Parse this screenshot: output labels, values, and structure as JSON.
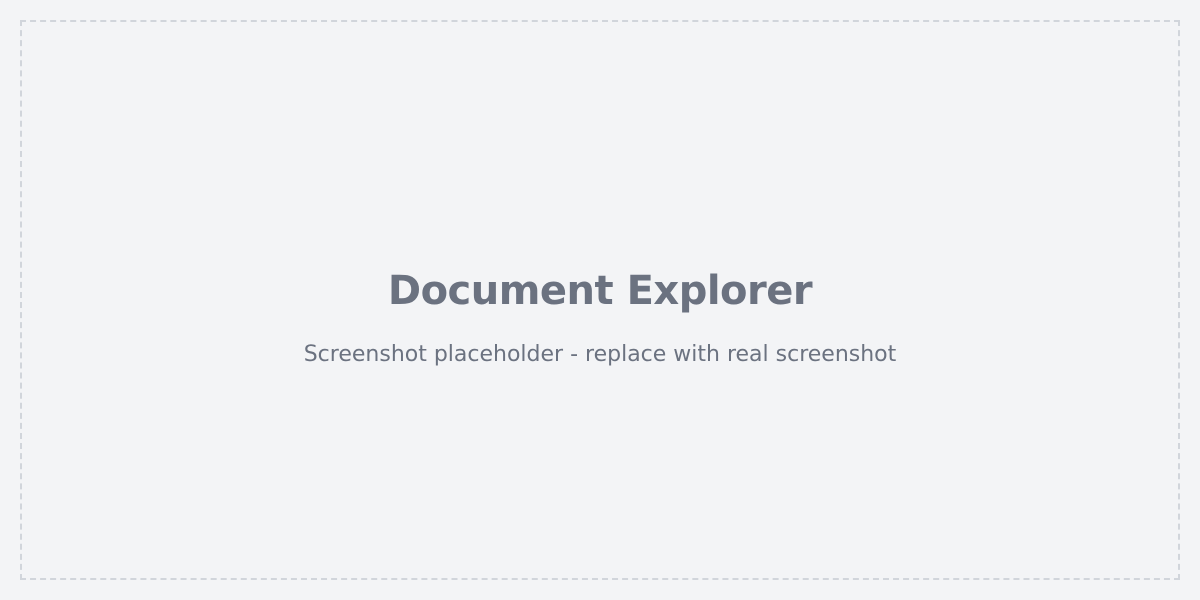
{
  "placeholder": {
    "title": "Document Explorer",
    "subtitle": "Screenshot placeholder - replace with real screenshot"
  },
  "colors": {
    "background": "#f3f4f6",
    "border": "#d1d5db",
    "text": "#6b7280"
  }
}
